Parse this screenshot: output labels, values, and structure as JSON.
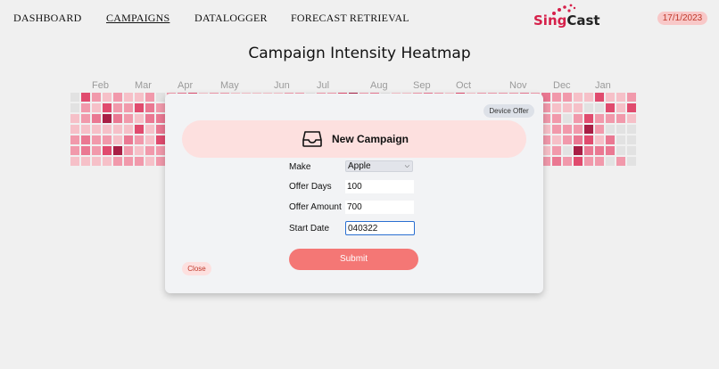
{
  "nav": {
    "items": [
      "DASHBOARD",
      "CAMPAIGNS",
      "DATALOGGER",
      "FORECAST RETRIEVAL"
    ],
    "active": "CAMPAIGNS",
    "logo_part1": "Sing",
    "logo_part2": "Cast",
    "date": "17/1/2023"
  },
  "page": {
    "title": "Campaign Intensity Heatmap"
  },
  "heatmap": {
    "months": [
      "Feb",
      "Mar",
      "Apr",
      "May",
      "Jun",
      "Jul",
      "Aug",
      "Sep",
      "Oct",
      "Nov",
      "Dec",
      "Jan"
    ],
    "colors": [
      "#e2e2e2",
      "#f6c0c8",
      "#f199ab",
      "#ea7892",
      "#e04b6e",
      "#a81f45"
    ]
  },
  "modal": {
    "badge": "Device Offer",
    "icon": "inbox-icon",
    "title": "New Campaign",
    "fields": {
      "make_label": "Make",
      "make_value": "Apple",
      "days_label": "Offer Days",
      "days_value": "100",
      "amount_label": "Offer Amount",
      "amount_value": "700",
      "date_label": "Start Date",
      "date_value": "040322"
    },
    "submit_label": "Submit",
    "close_label": "Close"
  }
}
